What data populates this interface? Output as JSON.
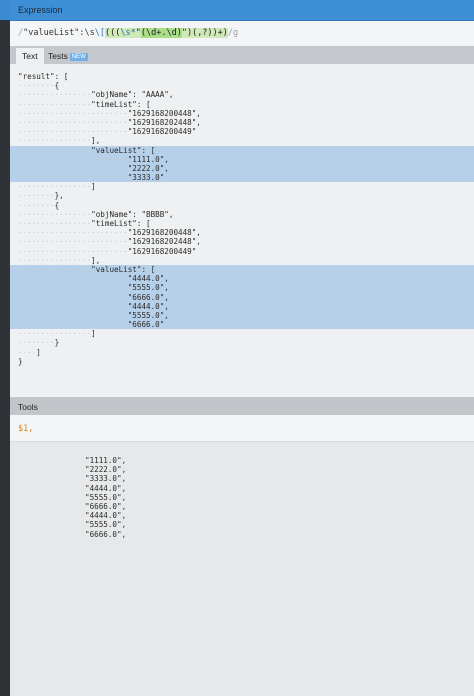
{
  "expression": {
    "header": "Expression",
    "open_delim": "/",
    "lit_key": "\"valueList\"",
    "lit_mid": ":\\s",
    "esc1": "\\[",
    "grp_open": "(((",
    "ws": "\\s*",
    "q1": "\"",
    "inner": "(\\d+.\\d)",
    "q2": "\"",
    "tail_grp": ")(,?))",
    "tail": "+)",
    "close_delim": "/",
    "flags": "g"
  },
  "tabs": [
    {
      "label": "Text"
    },
    {
      "label": "Tests",
      "badge": "NEW"
    }
  ],
  "text_lines": [
    {
      "ind": "",
      "txt": "\"result\": [",
      "hl": false
    },
    {
      "ind": "········",
      "txt": "{",
      "hl": false
    },
    {
      "ind": "················",
      "txt": "\"objName\": \"AAAA\",",
      "hl": false
    },
    {
      "ind": "················",
      "txt": "\"timeList\": [",
      "hl": false
    },
    {
      "ind": "························",
      "txt": "\"1629168200448\",",
      "hl": false
    },
    {
      "ind": "························",
      "txt": "\"1629168202448\",",
      "hl": false
    },
    {
      "ind": "························",
      "txt": "\"1629168200449\"",
      "hl": false
    },
    {
      "ind": "················",
      "txt": "],",
      "hl": false
    },
    {
      "ind": "················",
      "txt": "\"valueList\": [",
      "hl": true
    },
    {
      "ind": "························",
      "txt": "\"1111.0\",",
      "hl": true
    },
    {
      "ind": "························",
      "txt": "\"2222.0\",",
      "hl": true
    },
    {
      "ind": "························",
      "txt": "\"3333.0\"",
      "hl": true
    },
    {
      "ind": "················",
      "txt": "]",
      "hl": false
    },
    {
      "ind": "········",
      "txt": "},",
      "hl": false
    },
    {
      "ind": "········",
      "txt": "{",
      "hl": false
    },
    {
      "ind": "················",
      "txt": "\"objName\": \"BBBB\",",
      "hl": false
    },
    {
      "ind": "················",
      "txt": "\"timeList\": [",
      "hl": false
    },
    {
      "ind": "························",
      "txt": "\"1629168200448\",",
      "hl": false
    },
    {
      "ind": "························",
      "txt": "\"1629168202448\",",
      "hl": false
    },
    {
      "ind": "························",
      "txt": "\"1629168200449\"",
      "hl": false
    },
    {
      "ind": "················",
      "txt": "],",
      "hl": false
    },
    {
      "ind": "················",
      "txt": "\"valueList\": [",
      "hl": true
    },
    {
      "ind": "························",
      "txt": "\"4444.0\",",
      "hl": true
    },
    {
      "ind": "························",
      "txt": "\"5555.0\",",
      "hl": true
    },
    {
      "ind": "························",
      "txt": "\"6666.0\",",
      "hl": true
    },
    {
      "ind": "························",
      "txt": "\"4444.0\",",
      "hl": true
    },
    {
      "ind": "························",
      "txt": "\"5555.0\",",
      "hl": true
    },
    {
      "ind": "························",
      "txt": "\"6666.0\"",
      "hl": true
    },
    {
      "ind": "················",
      "txt": "]",
      "hl": false
    },
    {
      "ind": "········",
      "txt": "}",
      "hl": false
    },
    {
      "ind": "····",
      "txt": "]",
      "hl": false
    },
    {
      "ind": "",
      "txt": "}",
      "hl": false
    }
  ],
  "tools": {
    "header": "Tools",
    "expression": "$1,"
  },
  "result_lines": [
    "\"1111.0\",",
    "\"2222.0\",",
    "\"3333.0\",",
    "\"4444.0\",",
    "\"5555.0\",",
    "\"6666.0\",",
    "\"4444.0\",",
    "\"5555.0\",",
    "\"6666.0\","
  ]
}
